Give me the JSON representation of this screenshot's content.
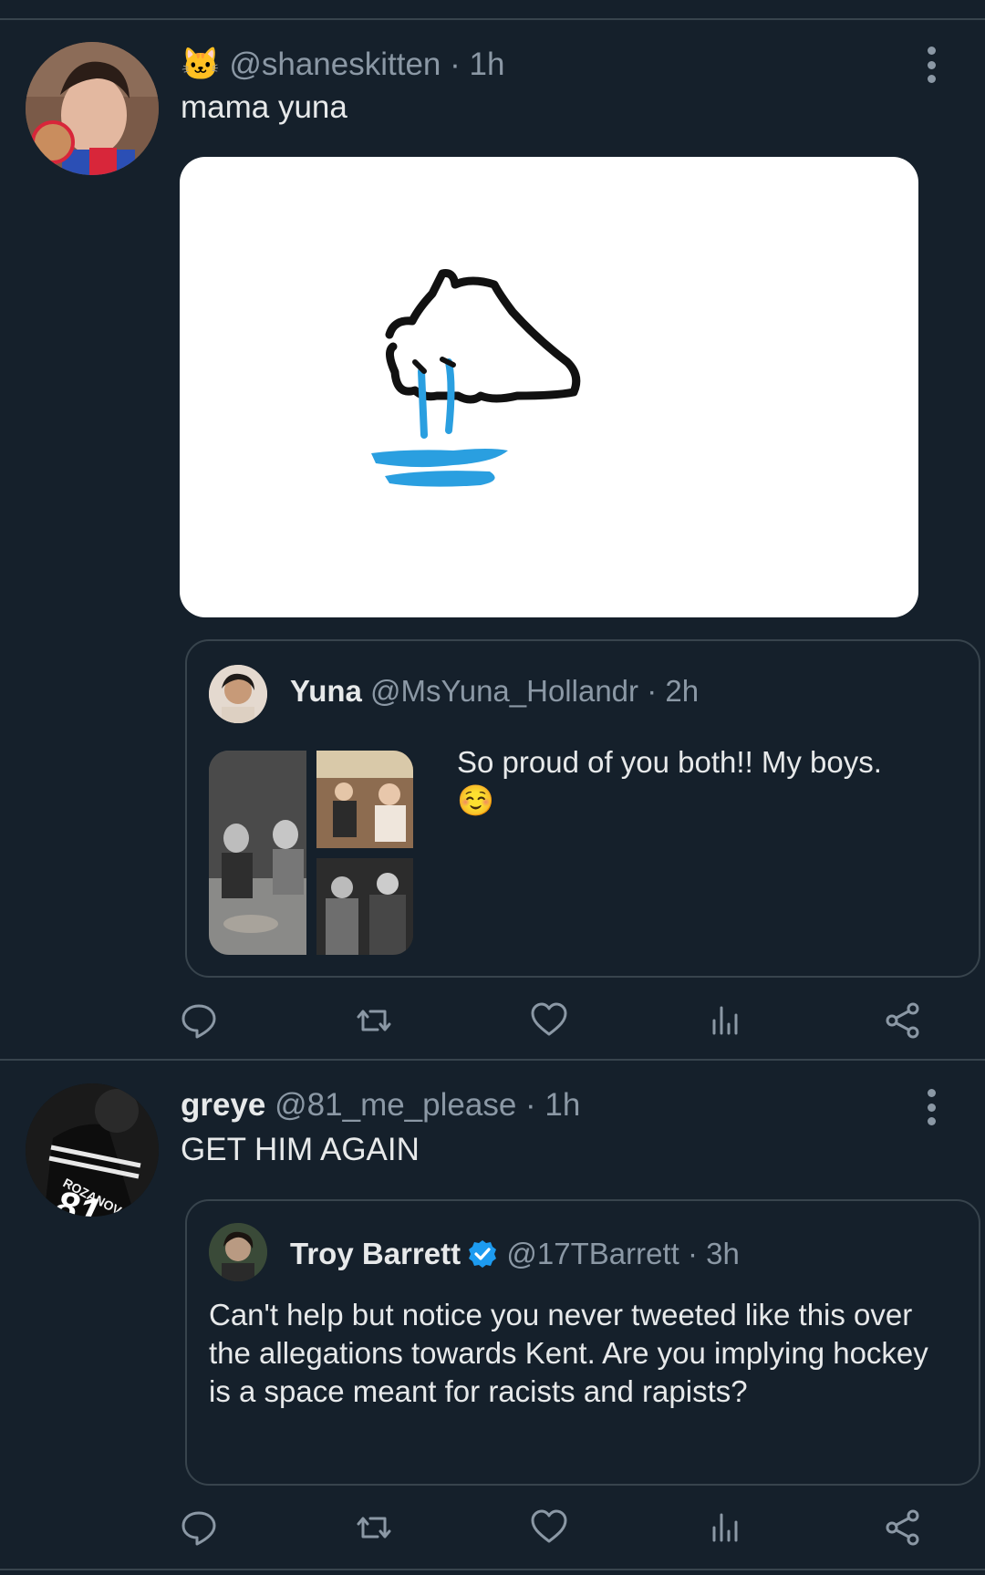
{
  "tweets": [
    {
      "handle_emoji": "🐱",
      "handle": "@shaneskitten",
      "time": "· 1h",
      "text": "mama yuna",
      "quote": {
        "name": "Yuna",
        "handle": "@MsYuna_Hollandr",
        "time": "· 2h",
        "text": "So proud of you both!! My boys.",
        "emoji": "☺️"
      }
    },
    {
      "name": "greye",
      "handle": "@81_me_please",
      "time": "· 1h",
      "text": "GET HIM AGAIN",
      "avatar_jersey_text": "ROZANOV",
      "avatar_jersey_number": "81",
      "quote": {
        "name": "Troy Barrett",
        "handle": "@17TBarrett",
        "time": "· 3h",
        "text": "Can't help but notice you never tweeted like this over the allegations towards Kent. Are you implying hockey is a space meant for racists and rapists?"
      }
    }
  ],
  "colors": {
    "background": "#15202b",
    "divider": "#38444d",
    "secondary_text": "#8b98a5",
    "verified": "#1d9bf0",
    "puddle": "#2a9fe0"
  },
  "action_icons": [
    "reply-icon",
    "retweet-icon",
    "like-icon",
    "views-icon",
    "share-icon"
  ]
}
